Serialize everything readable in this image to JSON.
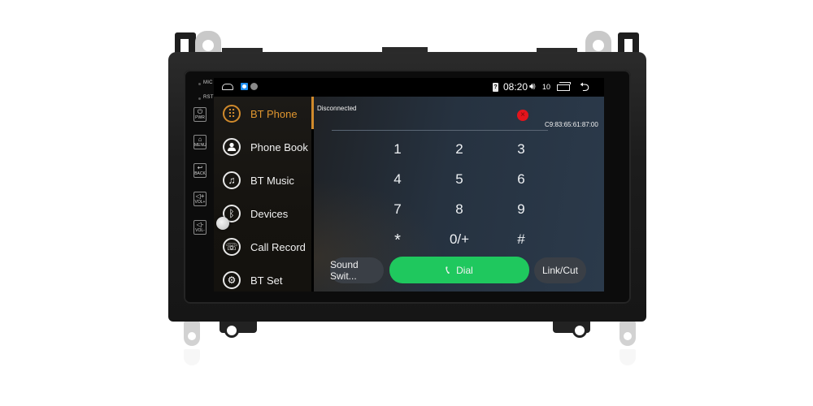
{
  "hardware": {
    "labels": {
      "mic": "MIC",
      "rst": "RST"
    },
    "buttons": [
      {
        "label": "PWR",
        "icon": "power-icon",
        "glyph": "⏻"
      },
      {
        "label": "MENU",
        "icon": "home-icon",
        "glyph": "⌂"
      },
      {
        "label": "BACK",
        "icon": "back-icon",
        "glyph": "↩"
      },
      {
        "label": "VOL+",
        "icon": "volume-up-icon",
        "glyph": "◁+"
      },
      {
        "label": "VOL-",
        "icon": "volume-down-icon",
        "glyph": "◁-"
      }
    ]
  },
  "statusbar": {
    "time": "08:20",
    "volume": "10",
    "icons": [
      "home-icon",
      "app-icon",
      "cast-icon",
      "bt-phone-status-icon",
      "volume-icon",
      "recent-apps-icon",
      "back-icon"
    ]
  },
  "sidebar": {
    "items": [
      {
        "label": "BT Phone",
        "icon": "dialpad-icon",
        "glyph": "⠿",
        "active": true
      },
      {
        "label": "Phone Book",
        "icon": "contact-icon",
        "glyph": "👤",
        "active": false
      },
      {
        "label": "BT Music",
        "icon": "music-note-icon",
        "glyph": "♫",
        "active": false
      },
      {
        "label": "Devices",
        "icon": "bluetooth-icon",
        "glyph": "ᛒ",
        "active": false
      },
      {
        "label": "Call Record",
        "icon": "call-log-icon",
        "glyph": "☏",
        "active": false
      },
      {
        "label": "BT Set",
        "icon": "settings-gear-icon",
        "glyph": "⚙",
        "active": false
      }
    ]
  },
  "main": {
    "connection_status": "Disconnected",
    "mac_address": "C9:83:65:61:87:00",
    "keypad": [
      "1",
      "2",
      "3",
      "4",
      "5",
      "6",
      "7",
      "8",
      "9",
      "*",
      "0/+",
      "#"
    ],
    "buttons": {
      "sound_switch": "Sound Swit...",
      "dial": "Dial",
      "link_cut": "Link/Cut"
    }
  },
  "colors": {
    "accent": "#e0962f",
    "dial_green": "#1fc85e",
    "disconnect_red": "#e3141c"
  }
}
